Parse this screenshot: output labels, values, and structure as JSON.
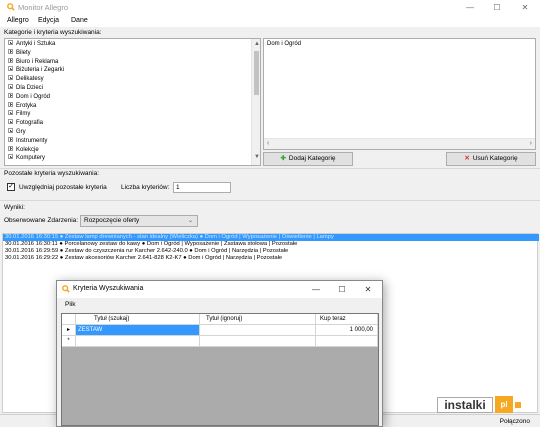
{
  "window": {
    "title": "Monitor Allegro",
    "minimize_glyph": "—",
    "maximize_glyph": "☐",
    "close_glyph": "✕"
  },
  "menu": [
    "Allegro",
    "Edycja",
    "Dane"
  ],
  "categories_section": {
    "label": "Kategorie i kryteria wyszukiwania:",
    "tree_items": [
      "Antyki i Sztuka",
      "Bilety",
      "Biuro i Reklama",
      "Biżuteria i Zegarki",
      "Delikatesy",
      "Dla Dzieci",
      "Dom i Ogród",
      "Erotyka",
      "Filmy",
      "Fotografia",
      "Gry",
      "Instrumenty",
      "Kolekcje",
      "Komputery"
    ],
    "selected_list": [
      "Dom i Ogród"
    ],
    "add_button": "Dodaj Kategorię",
    "remove_button": "Usuń Kategorię",
    "add_icon": "plus-icon",
    "remove_icon": "x-icon"
  },
  "other_criteria": {
    "label": "Pozostałe kryteria wyszukiwania:",
    "checkbox_label": "Uwzględniaj pozostałe kryteria",
    "checkbox_checked": true,
    "count_label": "Liczba kryteriów:",
    "count_value": "1"
  },
  "results": {
    "label": "Wyniki:",
    "events_label": "Obserwowane Zdarzenia:",
    "events_value": "Rozpoczęcie oferty",
    "log": [
      "30.01.2016 16:30:15 ● Zestaw lamp drewnianych - stan idealny (Wieliczka) ● Dom i Ogród | Wyposażenie | Oświetlenie | Lampy",
      "30.01.2016 16:30:11 ● Porcelanowy zestaw do kawy ● Dom i Ogród | Wyposażenie | Zastawa stołowa | Pozostałe",
      "30.01.2016 16:29:59 ● Zestaw do czyszczenia rur Karcher 2.642-240.0 ● Dom i Ogród | Narzędzia | Pozostałe",
      "30.01.2016 16:29:22 ● Zestaw akcesoriów Karcher 2.641-828 K2-K7 ● Dom i Ogród | Narzędzia | Pozostałe"
    ]
  },
  "dialog": {
    "title": "Kryteria Wyszukiwania",
    "menu": "Plik",
    "columns": [
      "Tytuł (szukaj)",
      "Tytuł (ignoruj)",
      "Kup teraz"
    ],
    "rows": [
      {
        "marker": "▸",
        "search": "ZESTAW",
        "ignore": "",
        "price": "1 000,00"
      },
      {
        "marker": "*",
        "search": "",
        "ignore": "",
        "price": ""
      }
    ]
  },
  "status": {
    "text": "Połączono"
  },
  "watermark": {
    "text": "instalki",
    "mark": "pl"
  },
  "colors": {
    "accent": "#3399ff",
    "logo_orange": "#f7a823",
    "remove_red": "#d9302c",
    "add_green": "#3aa33a"
  }
}
